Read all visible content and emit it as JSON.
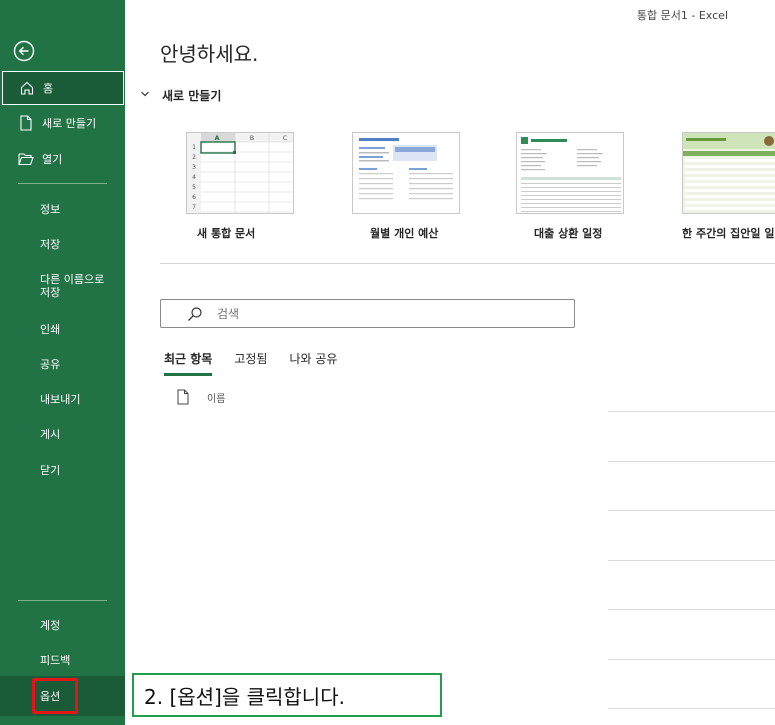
{
  "window": {
    "title": "통합 문서1  -  Excel"
  },
  "sidebar": {
    "home_label": "홈",
    "new_label": "새로 만들기",
    "open_label": "열기",
    "items": [
      "정보",
      "저장",
      "다른 이름으로 저장",
      "인쇄",
      "공유",
      "내보내기",
      "게시",
      "닫기"
    ],
    "account_label": "계정",
    "feedback_label": "피드백",
    "options_label": "옵션"
  },
  "main": {
    "greeting": "안녕하세요.",
    "new_section_title": "새로 만들기",
    "templates": [
      {
        "caption": "새 통합 문서"
      },
      {
        "caption": "월별 개인 예산"
      },
      {
        "caption": "대출 상환 일정"
      },
      {
        "caption": "한 주간의 집안일 일"
      }
    ],
    "search": {
      "placeholder": "검색"
    },
    "tabs": [
      "최근 항목",
      "고정됨",
      "나와 공유"
    ],
    "file_list_header": "이름"
  },
  "instruction": {
    "text": "2. [옵션]을 클릭합니다."
  },
  "colors": {
    "sidebar": "#217346",
    "highlight": "#e4141b",
    "instruction_border": "#21a04b"
  }
}
